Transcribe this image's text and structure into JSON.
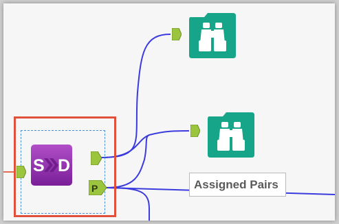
{
  "canvas": {
    "background": "#f6f6f6",
    "wire_color": "#3a3adf"
  },
  "tools": {
    "browse_1": {
      "icon": "binoculars-icon",
      "color": "#17a589"
    },
    "browse_2": {
      "icon": "binoculars-icon",
      "color": "#17a589"
    },
    "sd_tool": {
      "letter_left": "S",
      "letter_right": "D",
      "color": "#8e2aa8",
      "output_anchor_label": "P"
    }
  },
  "annotation": {
    "text": "Assigned Pairs"
  },
  "selection": {
    "highlight_color": "#e0503a"
  }
}
